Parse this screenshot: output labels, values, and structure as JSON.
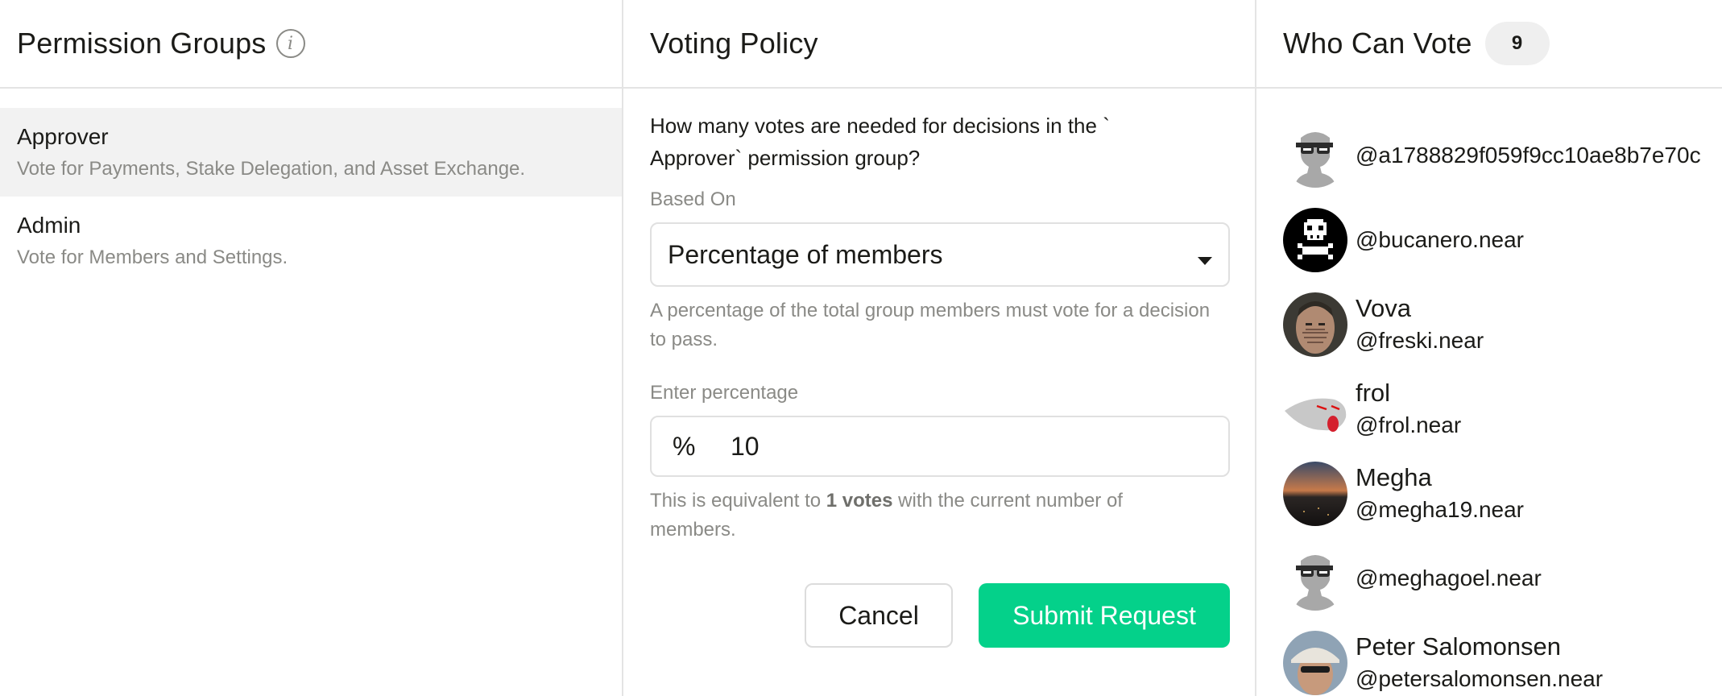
{
  "groups_panel": {
    "title": "Permission Groups",
    "items": [
      {
        "name": "Approver",
        "description": "Vote for Payments, Stake Delegation, and Asset Exchange.",
        "selected": true
      },
      {
        "name": "Admin",
        "description": "Vote for Members and Settings.",
        "selected": false
      }
    ]
  },
  "policy_panel": {
    "title": "Voting Policy",
    "question": "How many votes are needed for decisions in the ` Approver` permission group?",
    "based_on_label": "Based On",
    "based_on_value": "Percentage of members",
    "based_on_help": "A percentage of the total group members must vote for a decision to pass.",
    "percentage_label": "Enter percentage",
    "percent_symbol": "%",
    "percentage_value": "10",
    "equivalent_prefix": "This is equivalent to ",
    "equivalent_votes": "1 votes",
    "equivalent_suffix": " with the current number of members.",
    "cancel_label": "Cancel",
    "submit_label": "Submit Request"
  },
  "voters_panel": {
    "title": "Who Can Vote",
    "count": "9",
    "voters": [
      {
        "name": "",
        "handle": "@a1788829f059f9cc10ae8b7e70c",
        "avatar": "default-silhouette-avatar"
      },
      {
        "name": "",
        "handle": "@bucanero.near",
        "avatar": "pixel-skull-avatar"
      },
      {
        "name": "Vova",
        "handle": "@freski.near",
        "avatar": "photo-face-avatar"
      },
      {
        "name": "frol",
        "handle": "@frol.near",
        "avatar": "ghost-tongue-avatar"
      },
      {
        "name": "Megha",
        "handle": "@megha19.near",
        "avatar": "sunset-photo-avatar"
      },
      {
        "name": "",
        "handle": "@meghagoel.near",
        "avatar": "default-silhouette-avatar"
      },
      {
        "name": "Peter Salomonsen",
        "handle": "@petersalomonsen.near",
        "avatar": "photo-hat-avatar"
      }
    ]
  },
  "colors": {
    "accent": "#04d18a",
    "selected_row": "#f2f2f2",
    "muted_text": "#8a8a86",
    "border": "#e4e4e4"
  }
}
